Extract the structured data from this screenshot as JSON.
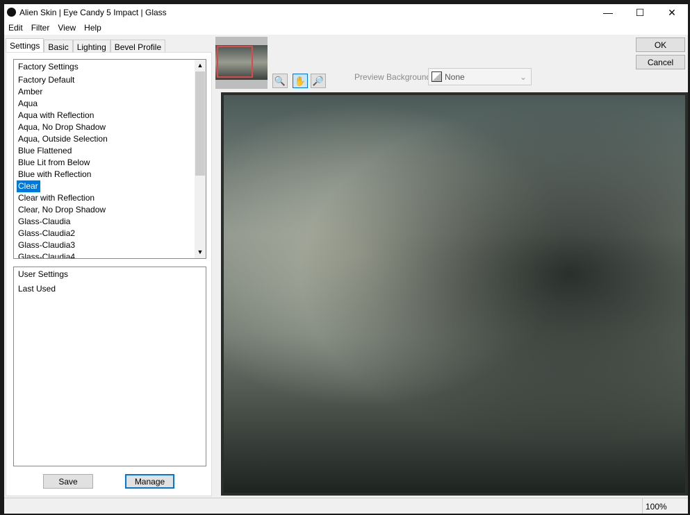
{
  "window": {
    "title": "Alien Skin | Eye Candy 5 Impact | Glass",
    "minimize": "—",
    "maximize": "☐",
    "close": "✕"
  },
  "menu": [
    "Edit",
    "Filter",
    "View",
    "Help"
  ],
  "tabs": [
    "Settings",
    "Basic",
    "Lighting",
    "Bevel Profile"
  ],
  "factory_settings": {
    "header": "Factory Settings",
    "items": [
      "Factory Default",
      "Amber",
      "Aqua",
      "Aqua with Reflection",
      "Aqua, No Drop Shadow",
      "Aqua, Outside Selection",
      "Blue Flattened",
      "Blue Lit from Below",
      "Blue with Reflection",
      "Clear",
      "Clear with Reflection",
      "Clear, No Drop Shadow",
      "Glass-Claudia",
      "Glass-Claudia2",
      "Glass-Claudia3",
      "Glass-Claudia4"
    ],
    "selected": "Clear"
  },
  "user_settings": {
    "header": "User Settings",
    "items": [
      "Last Used"
    ]
  },
  "buttons": {
    "save": "Save",
    "manage": "Manage",
    "ok": "OK",
    "cancel": "Cancel"
  },
  "preview_background": {
    "label": "Preview Background:",
    "value": "None"
  },
  "status": {
    "zoom": "100%"
  },
  "colors": {
    "selection": "#0078d7",
    "nav_box": "#e04848"
  }
}
